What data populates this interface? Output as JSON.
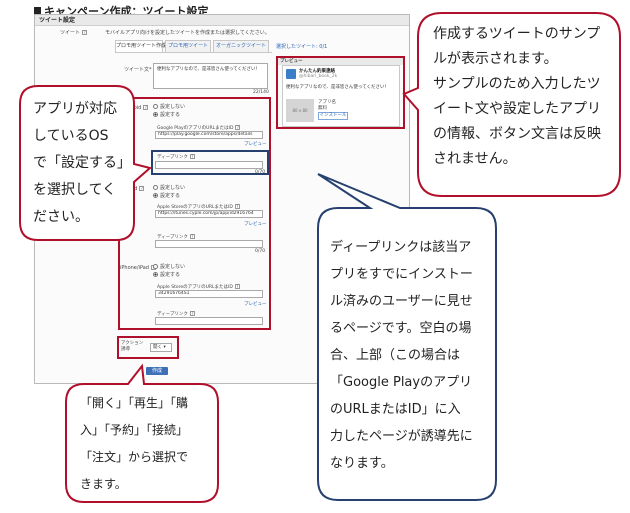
{
  "page": {
    "title": "キャンペーン作成：ツイート設定"
  },
  "panel": {
    "header": "ツイート設定",
    "tweet_row_label": "ツイート",
    "tweet_row_note": "モバイルアプリ向けを設定したツイートを作成または選択してください。",
    "tabs": [
      "プロモ用ツイート作成",
      "プロモ用ツイート",
      "オーガニックツイート",
      "選択したツイート: 0/1"
    ],
    "tweet_text_label": "ツイート文*",
    "tweet_text_value": "便利なアプリなので、是非皆さん使ってください！",
    "tweet_counter": "22/140"
  },
  "settings": {
    "radio_disable": "設定しない",
    "radio_enable": "設定する",
    "deeplink_label": "ディープリンク",
    "preview_link": "プレビュー",
    "counter": "0/70",
    "android": {
      "label": "Android",
      "url_label": "Google PlayのアプリのURLまたはID",
      "url_value": "https://play.google.com/store/apps/details"
    },
    "ipad": {
      "label": "iPad",
      "url_label": "Apple StoreのアプリのURLまたはID",
      "url_value": "https://itunes.cyple.com/jp/app/id2916764"
    },
    "iphone": {
      "label": "iPhone/iPad",
      "url_label": "Apple StoreのアプリのURLまたはID",
      "url_value": "342916764S1"
    }
  },
  "action": {
    "label": "アクション誘導",
    "selected": "開く",
    "create_button": "作成"
  },
  "preview": {
    "header": "プレビュー",
    "account_name": "かんたん釣果連絡",
    "account_handle": "@hibari_book_2k",
    "tweet_text": "便利なアプリなので、是非皆さん使ってください！",
    "app_name": "アプリ名",
    "app_price": "無料",
    "thumb_label": "80 x 80",
    "install_button": "インストール"
  },
  "callouts": {
    "preview": [
      "作成するツイートのサンプ",
      "ルが表示されます。",
      "サンプルのため入力したツ",
      "イート文や設定したアプリ",
      "の情報、ボタン文言は反映",
      "されません。"
    ],
    "os": [
      "アプリが対応",
      "しているOS",
      "で「設定する」",
      "を選択してく",
      "ださい。"
    ],
    "deeplink": [
      "ディープリンクは該当ア",
      "プリをすでにインストー",
      "ル済みのユーザーに見せ",
      "るページです。空白の場",
      "合、上部（この場合は",
      "「Google Playのアプリ",
      "のURLまたはID」に入",
      "力したページが誘導先に",
      "なります。"
    ],
    "action": [
      "「開く」「再生」「購",
      "入」「予約」「接続」",
      "「注文」から選択で",
      "きます。"
    ]
  },
  "colors": {
    "accent_red": "#b0102b",
    "accent_navy": "#26416f",
    "link_blue": "#2763b6"
  }
}
